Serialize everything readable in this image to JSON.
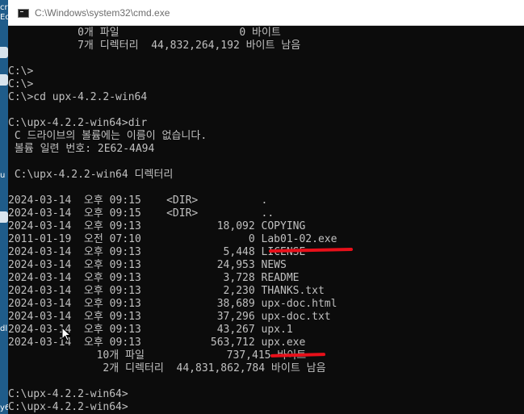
{
  "window": {
    "title": "C:\\Windows\\system32\\cmd.exe"
  },
  "console": {
    "lines": [
      "           0개 파일                   0 바이트",
      "           7개 디렉터리  44,832,264,192 바이트 남음",
      "",
      "C:\\>",
      "C:\\>",
      "C:\\>cd upx-4.2.2-win64",
      "",
      "C:\\upx-4.2.2-win64>dir",
      " C 드라이브의 볼륨에는 이름이 없습니다.",
      " 볼륨 일련 번호: 2E62-4A94",
      "",
      " C:\\upx-4.2.2-win64 디렉터리",
      "",
      "2024-03-14  오후 09:15    <DIR>          .",
      "2024-03-14  오후 09:15    <DIR>          ..",
      "2024-03-14  오후 09:13            18,092 COPYING",
      "2011-01-19  오전 07:10                 0 Lab01-02.exe",
      "2024-03-14  오후 09:13             5,448 LICENSE",
      "2024-03-14  오후 09:13            24,953 NEWS",
      "2024-03-14  오후 09:13             3,728 README",
      "2024-03-14  오후 09:13             2,230 THANKS.txt",
      "2024-03-14  오후 09:13            38,689 upx-doc.html",
      "2024-03-14  오후 09:13            37,296 upx-doc.txt",
      "2024-03-14  오후 09:13            43,267 upx.1",
      "2024-03-14  오후 09:13           563,712 upx.exe",
      "              10개 파일             737,415 바이트",
      "               2개 디렉터리  44,831,862,784 바이트 남음",
      "",
      "C:\\upx-4.2.2-win64>",
      "C:\\upx-4.2.2-win64>"
    ]
  },
  "desktop": {
    "fragments": [
      "cr",
      "Ed",
      "u",
      "dl",
      "y6"
    ]
  },
  "colors": {
    "console_bg": "#0c0c0c",
    "console_text": "#c0c0c0",
    "titlebar_bg": "#ffffff",
    "title_text": "#6d6d6d",
    "annotation_red": "#e8101a"
  }
}
